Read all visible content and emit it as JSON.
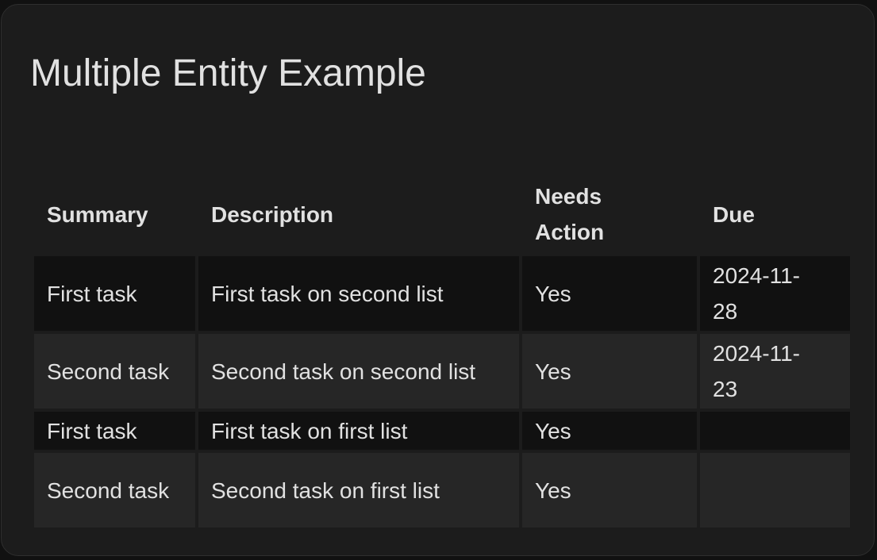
{
  "card": {
    "title": "Multiple Entity Example"
  },
  "table": {
    "headers": [
      "Summary",
      "Description",
      "Needs Action",
      "Due"
    ],
    "rows": [
      {
        "summary": "First task",
        "description": "First task on second list",
        "needs_action": "Yes",
        "due": "2024-11-28"
      },
      {
        "summary": "Second task",
        "description": "Second task on second list",
        "needs_action": "Yes",
        "due": "2024-11-23"
      },
      {
        "summary": "First task",
        "description": "First task on first list",
        "needs_action": "Yes",
        "due": ""
      },
      {
        "summary": "Second task",
        "description": "Second task on first list",
        "needs_action": "Yes",
        "due": ""
      }
    ]
  },
  "colors": {
    "card_background": "#1c1c1c",
    "page_background": "#111111",
    "row_dark": "#111111",
    "row_light": "#262626",
    "text": "#e1e1e1"
  }
}
